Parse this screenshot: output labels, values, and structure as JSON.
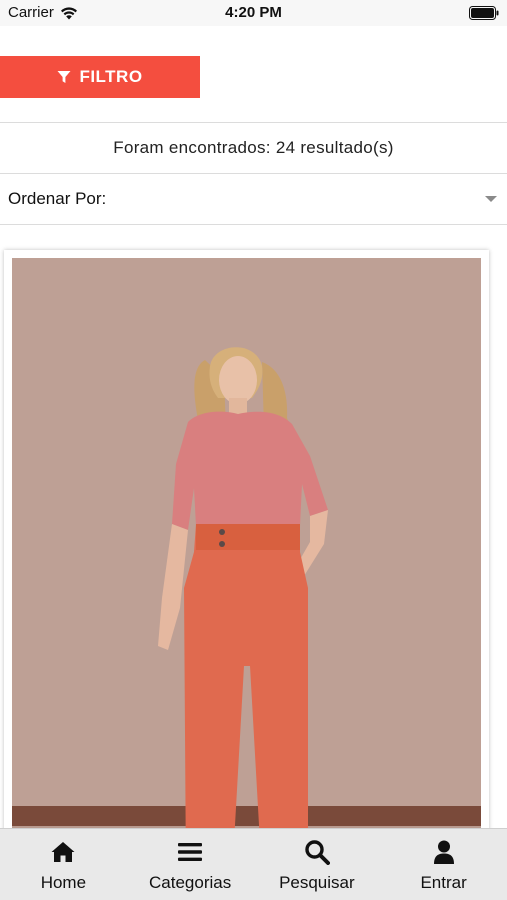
{
  "status_bar": {
    "carrier": "Carrier",
    "time": "4:20 PM"
  },
  "filter_button": {
    "label": "FILTRO",
    "color": "#f44e3f"
  },
  "results": {
    "text": "Foram encontrados: 24 resultado(s)"
  },
  "sort": {
    "label": "Ordenar Por:"
  },
  "product_list": {
    "count": 24
  },
  "tab_bar": {
    "tabs": [
      {
        "label": "Home",
        "icon": "home-icon"
      },
      {
        "label": "Categorias",
        "icon": "menu-icon"
      },
      {
        "label": "Pesquisar",
        "icon": "search-icon"
      },
      {
        "label": "Entrar",
        "icon": "user-icon"
      }
    ]
  }
}
